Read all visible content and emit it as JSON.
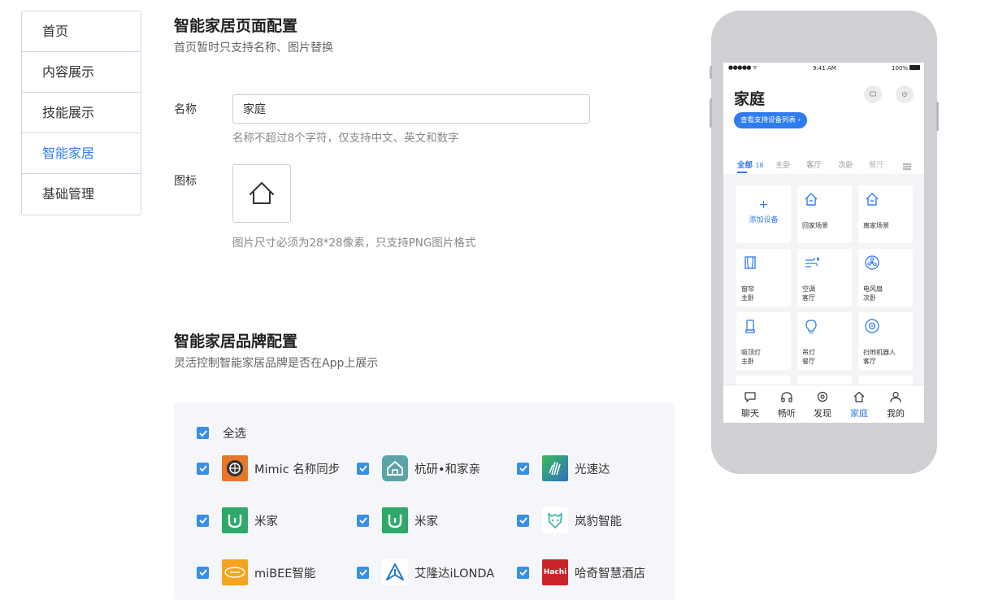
{
  "menu": {
    "items": [
      {
        "label": "首页"
      },
      {
        "label": "内容展示"
      },
      {
        "label": "技能展示"
      },
      {
        "label": "智能家居"
      },
      {
        "label": "基础管理"
      }
    ]
  },
  "page_config": {
    "title": "智能家居页面配置",
    "subtitle": "首页暂时只支持名称、图片替换",
    "name_label": "名称",
    "name_value": "家庭",
    "name_hint": "名称不超过8个字符，仅支持中文、英文和数字",
    "icon_label": "图标",
    "icon_name": "home-icon",
    "icon_hint": "图片尺寸必须为28*28像素，只支持PNG图片格式"
  },
  "brand_config": {
    "title": "智能家居品牌配置",
    "subtitle": "灵活控制智能家居品牌是否在App上展示",
    "select_all": "全选",
    "brands": [
      {
        "name": "Mimic 名称同步",
        "checked": true,
        "logo": "mimic-logo",
        "color": "#e8772a"
      },
      {
        "name": "杭研•和家亲",
        "checked": true,
        "logo": "hejiaqin-logo",
        "color": "#5ba3a8"
      },
      {
        "name": "光速达",
        "checked": true,
        "logo": "guangsuda-logo",
        "color": "#2b6fc4"
      },
      {
        "name": "米家",
        "checked": true,
        "logo": "mijia-logo",
        "color": "#2fa86a"
      },
      {
        "name": "米家",
        "checked": true,
        "logo": "mijia-logo",
        "color": "#2fa86a"
      },
      {
        "name": "岚豹智能",
        "checked": true,
        "logo": "lanbao-logo",
        "color": "#44b3b0"
      },
      {
        "name": "miBEE智能",
        "checked": true,
        "logo": "mibee-logo",
        "color": "#f3a51f"
      },
      {
        "name": "艾隆达iLONDA",
        "checked": true,
        "logo": "ilonda-logo",
        "color": "#2a78c8"
      },
      {
        "name": "哈奇智慧酒店",
        "checked": true,
        "logo": "hachi-logo",
        "color": "#c8242a",
        "logo_text": "Hachi"
      }
    ]
  },
  "phone_preview": {
    "status": {
      "signal": "●●●●● ᯤ",
      "time": "9:41 AM",
      "battery": "100%"
    },
    "title": "家庭",
    "pill": "查看支持设备列表 ›",
    "tabs": [
      {
        "label": "全部",
        "count": "18",
        "active": true
      },
      {
        "label": "主卧"
      },
      {
        "label": "客厅"
      },
      {
        "label": "次卧"
      },
      {
        "label": "餐厅"
      }
    ],
    "add_device": "添加设备",
    "devices": [
      {
        "name": "回家场景",
        "room": "",
        "icon": "home-scene-icon"
      },
      {
        "name": "离家场景",
        "room": "",
        "icon": "leave-scene-icon"
      },
      {
        "name": "窗帘",
        "room": "主卧",
        "icon": "curtain-icon"
      },
      {
        "name": "空调",
        "room": "客厅",
        "icon": "air-conditioner-icon"
      },
      {
        "name": "电风扇",
        "room": "次卧",
        "icon": "fan-icon"
      },
      {
        "name": "吸顶灯",
        "room": "主卧",
        "icon": "ceiling-light-icon"
      },
      {
        "name": "吊灯",
        "room": "餐厅",
        "icon": "bulb-icon"
      },
      {
        "name": "扫地机器人",
        "room": "客厅",
        "icon": "robot-vacuum-icon"
      }
    ],
    "tabbar": [
      {
        "label": "聊天",
        "icon": "chat-icon"
      },
      {
        "label": "畅听",
        "icon": "headphones-icon"
      },
      {
        "label": "发现",
        "icon": "discover-icon"
      },
      {
        "label": "家庭",
        "icon": "home-icon",
        "active": true
      },
      {
        "label": "我的",
        "icon": "user-icon"
      }
    ],
    "accent": "#2f7bf0"
  }
}
